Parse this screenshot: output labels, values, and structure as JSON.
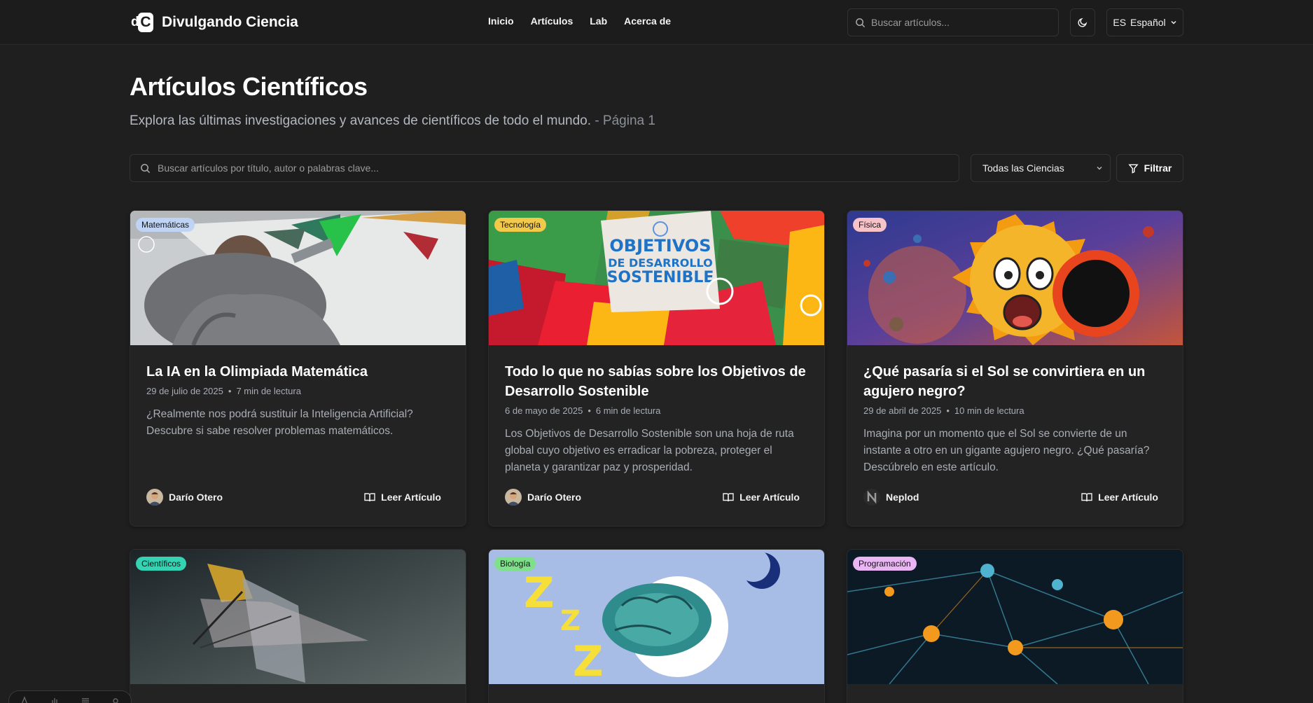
{
  "brand": {
    "mark_left": "d",
    "mark_right": "C",
    "name": "Divulgando Ciencia"
  },
  "nav": {
    "links": [
      "Inicio",
      "Artículos",
      "Lab",
      "Acerca de"
    ]
  },
  "top_search": {
    "placeholder": "Buscar artículos..."
  },
  "language": {
    "code": "ES",
    "label": "Español"
  },
  "header": {
    "title": "Artículos Científicos",
    "subtitle": "Explora las últimas investigaciones y avances de científicos de todo el mundo.",
    "page_label": "- Página 1"
  },
  "main_search": {
    "placeholder": "Buscar artículos por título, autor o palabras clave..."
  },
  "category_select": {
    "value": "Todas las Ciencias"
  },
  "filter_button": {
    "label": "Filtrar"
  },
  "read_label": "Leer Artículo",
  "colors": {
    "badge_matematicas": "#bfd4f4",
    "badge_tecnologia": "#f3c94a",
    "badge_fisica": "#f7c3c8",
    "badge_cientificos": "#34d3b4",
    "badge_biologia": "#7ee08a",
    "badge_programacion": "#e9b6f3"
  },
  "articles": [
    {
      "category": "Matemáticas",
      "title": "La IA en la Olimpiada Matemática",
      "date": "29 de julio de 2025",
      "read_time": "7 min de lectura",
      "excerpt": "¿Realmente nos podrá sustituir la Inteligencia Artificial? Descubre si sabe resolver problemas matemáticos.",
      "author": "Darío Otero"
    },
    {
      "category": "Tecnología",
      "title": "Todo lo que no sabías sobre los Objetivos de Desarrollo Sostenible",
      "date": "6 de mayo de 2025",
      "read_time": "6 min de lectura",
      "excerpt": "Los Objetivos de Desarrollo Sostenible son una hoja de ruta global cuyo objetivo es erradicar la pobreza, proteger el planeta y garantizar paz y prosperidad.",
      "author": "Darío Otero",
      "image_text": {
        "line1": "OBJETIVOS",
        "line2": "DE DESARROLLO",
        "line3": "SOSTENIBLE"
      }
    },
    {
      "category": "Física",
      "title": "¿Qué pasaría si el Sol se convirtiera en un agujero negro?",
      "date": "29 de abril de 2025",
      "read_time": "10 min de lectura",
      "excerpt": "Imagina por un momento que el Sol se convierte de un instante a otro en un gigante agujero negro. ¿Qué pasaría? Descúbrelo en este artículo.",
      "author": "Neplod"
    },
    {
      "category": "Científicos"
    },
    {
      "category": "Biología"
    },
    {
      "category": "Programación"
    }
  ]
}
